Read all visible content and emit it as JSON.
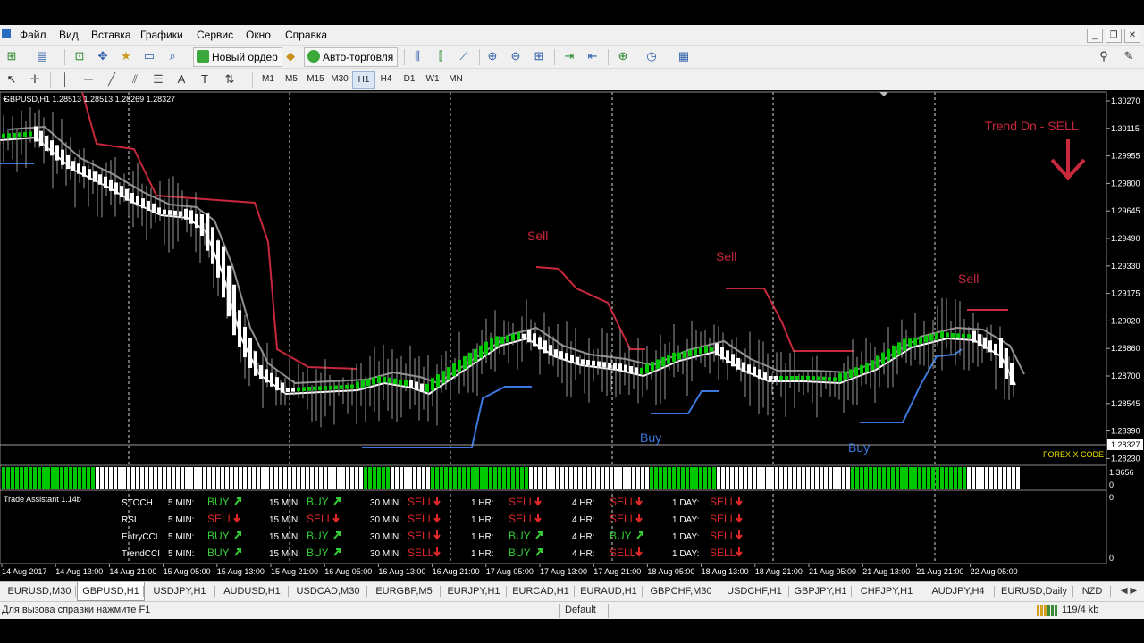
{
  "menu": {
    "items": [
      "Файл",
      "Вид",
      "Вставка",
      "Графики",
      "Сервис",
      "Окно",
      "Справка"
    ]
  },
  "toolbar": {
    "new_order_label": "Новый ордер",
    "auto_trading_label": "Авто-торговля",
    "timeframes": [
      "M1",
      "M5",
      "M15",
      "M30",
      "H1",
      "H4",
      "D1",
      "W1",
      "MN"
    ],
    "active_timeframe": "H1"
  },
  "chart": {
    "symbol_header": "GBPUSD,H1  1.28513 1.28513 1.28269 1.28327",
    "current_price": "1.28327",
    "price_ticks": [
      "1.30270",
      "1.30115",
      "1.29955",
      "1.29800",
      "1.29645",
      "1.29490",
      "1.29330",
      "1.29175",
      "1.29020",
      "1.28860",
      "1.28700",
      "1.28545",
      "1.28390",
      "1.28230"
    ],
    "trend_text": "Trend Dn - SELL",
    "sell_labels": [
      "Sell",
      "Sell",
      "Sell"
    ],
    "buy_labels": [
      "Buy",
      "Buy"
    ],
    "watermark": "FOREX X CODE",
    "indicator_scale": [
      "1.3656",
      "0"
    ],
    "assistant_scale": [
      "0"
    ],
    "date_ticks": [
      "14 Aug 2017",
      "14 Aug 13:00",
      "14 Aug 21:00",
      "15 Aug 05:00",
      "15 Aug 13:00",
      "15 Aug 21:00",
      "16 Aug 05:00",
      "16 Aug 13:00",
      "16 Aug 21:00",
      "17 Aug 05:00",
      "17 Aug 13:00",
      "17 Aug 21:00",
      "18 Aug 05:00",
      "18 Aug 13:00",
      "18 Aug 21:00",
      "21 Aug 05:00",
      "21 Aug 13:00",
      "21 Aug 21:00",
      "22 Aug 05:00"
    ],
    "colors": {
      "bull": "#00c800",
      "bear": "#ffffff",
      "sell_line": "#c8283c",
      "buy_line": "#3c78dc",
      "ma": "#909090"
    }
  },
  "trade_assistant": {
    "title": "Trade Assistant 1.14b",
    "timeframes": [
      "5 MIN:",
      "15 MIN:",
      "30 MIN:",
      "1 HR:",
      "4 HR:",
      "1 DAY:"
    ],
    "rows": [
      {
        "name": "STOCH",
        "signals": [
          "BUY",
          "BUY",
          "SELL",
          "SELL",
          "SELL",
          "SELL"
        ]
      },
      {
        "name": "RSI",
        "signals": [
          "SELL",
          "SELL",
          "SELL",
          "SELL",
          "SELL",
          "SELL"
        ]
      },
      {
        "name": "EntryCCI",
        "signals": [
          "BUY",
          "BUY",
          "SELL",
          "BUY",
          "BUY",
          "SELL"
        ]
      },
      {
        "name": "TrendCCI",
        "signals": [
          "BUY",
          "BUY",
          "SELL",
          "BUY",
          "SELL",
          "SELL"
        ]
      }
    ]
  },
  "tabs": [
    "EURUSD,M30",
    "GBPUSD,H1",
    "USDJPY,H1",
    "AUDUSD,H1",
    "USDCAD,M30",
    "EURGBP,M5",
    "EURJPY,H1",
    "EURCAD,H1",
    "EURAUD,H1",
    "GBPCHF,M30",
    "USDCHF,H1",
    "GBPJPY,H1",
    "CHFJPY,H1",
    "AUDJPY,H4",
    "EURUSD,Daily",
    "NZD"
  ],
  "active_tab": "GBPUSD,H1",
  "status": {
    "help": "Для вызова справки нажмите F1",
    "profile": "Default",
    "traffic": "119/4 kb"
  }
}
